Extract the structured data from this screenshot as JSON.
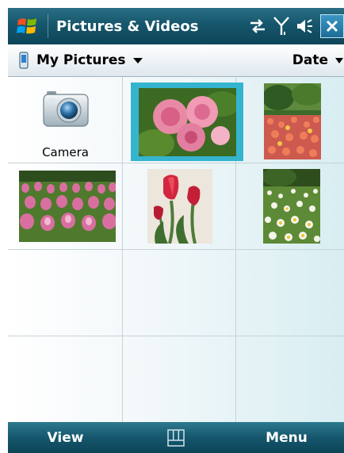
{
  "title_bar": {
    "title": "Pictures & Videos",
    "icons": [
      "windows-start-icon",
      "connectivity-icon",
      "signal-icon",
      "volume-icon",
      "close-icon"
    ],
    "accent_color": "#16566c"
  },
  "subheader": {
    "folder_label": "My Pictures",
    "sort_label": "Date"
  },
  "grid": {
    "items": [
      {
        "type": "camera",
        "label": "Camera"
      },
      {
        "type": "photo",
        "subject": "pink roses",
        "selected": true
      },
      {
        "type": "photo",
        "subject": "tulip garden"
      },
      {
        "type": "photo",
        "subject": "pink tulip field"
      },
      {
        "type": "photo",
        "subject": "red tulips"
      },
      {
        "type": "photo",
        "subject": "white daisies"
      }
    ],
    "selection_color": "#35b4cf"
  },
  "softkeys": {
    "left": "View",
    "right": "Menu"
  }
}
